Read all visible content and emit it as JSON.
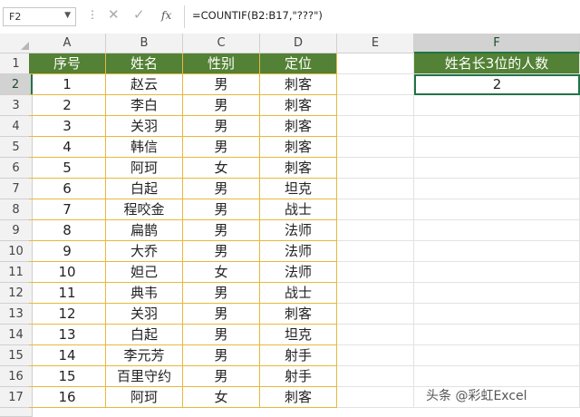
{
  "formula_bar": {
    "name_box": "F2",
    "name_box_arrow_icon": "chevron-down-icon",
    "more_icon": "vertical-dots-icon",
    "cancel_icon": "cancel-x-icon",
    "confirm_icon": "checkmark-icon",
    "fx_label": "fx",
    "formula": "=COUNTIF(B2:B17,\"???\")"
  },
  "columns": [
    "A",
    "B",
    "C",
    "D",
    "E",
    "F"
  ],
  "selected_column": "F",
  "selected_row": "2",
  "row_numbers": [
    "1",
    "2",
    "3",
    "4",
    "5",
    "6",
    "7",
    "8",
    "9",
    "10",
    "11",
    "12",
    "13",
    "14",
    "15",
    "16",
    "17"
  ],
  "table": {
    "headers": [
      "序号",
      "姓名",
      "性别",
      "定位"
    ],
    "rows": [
      [
        "1",
        "赵云",
        "男",
        "刺客"
      ],
      [
        "2",
        "李白",
        "男",
        "刺客"
      ],
      [
        "3",
        "关羽",
        "男",
        "刺客"
      ],
      [
        "4",
        "韩信",
        "男",
        "刺客"
      ],
      [
        "5",
        "阿珂",
        "女",
        "刺客"
      ],
      [
        "6",
        "白起",
        "男",
        "坦克"
      ],
      [
        "7",
        "程咬金",
        "男",
        "战士"
      ],
      [
        "8",
        "扁鹊",
        "男",
        "法师"
      ],
      [
        "9",
        "大乔",
        "男",
        "法师"
      ],
      [
        "10",
        "妲己",
        "女",
        "法师"
      ],
      [
        "11",
        "典韦",
        "男",
        "战士"
      ],
      [
        "12",
        "关羽",
        "男",
        "刺客"
      ],
      [
        "13",
        "白起",
        "男",
        "坦克"
      ],
      [
        "14",
        "李元芳",
        "男",
        "射手"
      ],
      [
        "15",
        "百里守约",
        "男",
        "射手"
      ],
      [
        "16",
        "阿珂",
        "女",
        "刺客"
      ]
    ]
  },
  "result": {
    "header": "姓名长3位的人数",
    "value": "2"
  },
  "colors": {
    "header_green": "#538135",
    "table_border": "#e6b93c",
    "selection_green": "#217346"
  },
  "watermark": "头条 @彩虹Excel"
}
